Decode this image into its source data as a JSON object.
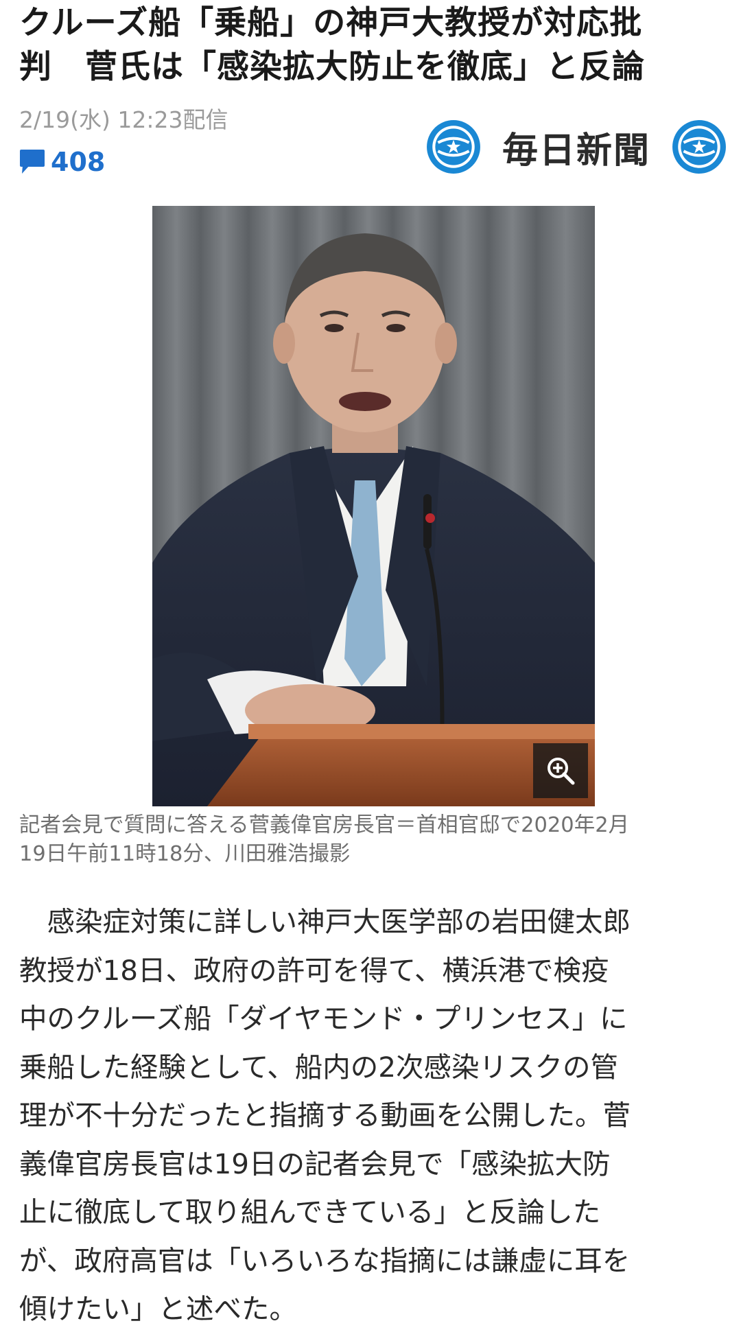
{
  "article": {
    "title_lines": [
      "クルーズ船「乗船」の神戸大教授が対応批",
      "判　菅氏は「感染拡大防止を徹底」と反論"
    ],
    "published": "2/19(水) 12:23配信",
    "comment_count": "408",
    "publisher": "毎日新聞",
    "caption_lines": [
      "記者会見で質問に答える菅義偉官房長官＝首相官邸で2020年2月",
      "19日午前11時18分、川田雅浩撮影"
    ],
    "body_lines": [
      "　感染症対策に詳しい神戸大医学部の岩田健太郎",
      "教授が18日、政府の許可を得て、横浜港で検疫",
      "中のクルーズ船「ダイヤモンド・プリンセス」に",
      "乗船した経験として、船内の2次感染リスクの管",
      "理が不十分だったと指摘する動画を公開した。菅",
      "義偉官房長官は19日の記者会見で「感染拡大防",
      "止に徹底して取り組んできている」と反論した",
      "が、政府高官は「いろいろな指摘には謙虚に耳を",
      "傾けたい」と述べた。"
    ]
  },
  "icons": {
    "comment": "speech-bubble-icon",
    "publisher_logo": "mainichi-emblem-icon",
    "zoom": "zoom-in-icon"
  },
  "colors": {
    "accent": "#1f6fcc",
    "logo_blue": "#1a88d4",
    "meta_gray": "#9a9a9a",
    "caption_gray": "#6f6f6f"
  }
}
